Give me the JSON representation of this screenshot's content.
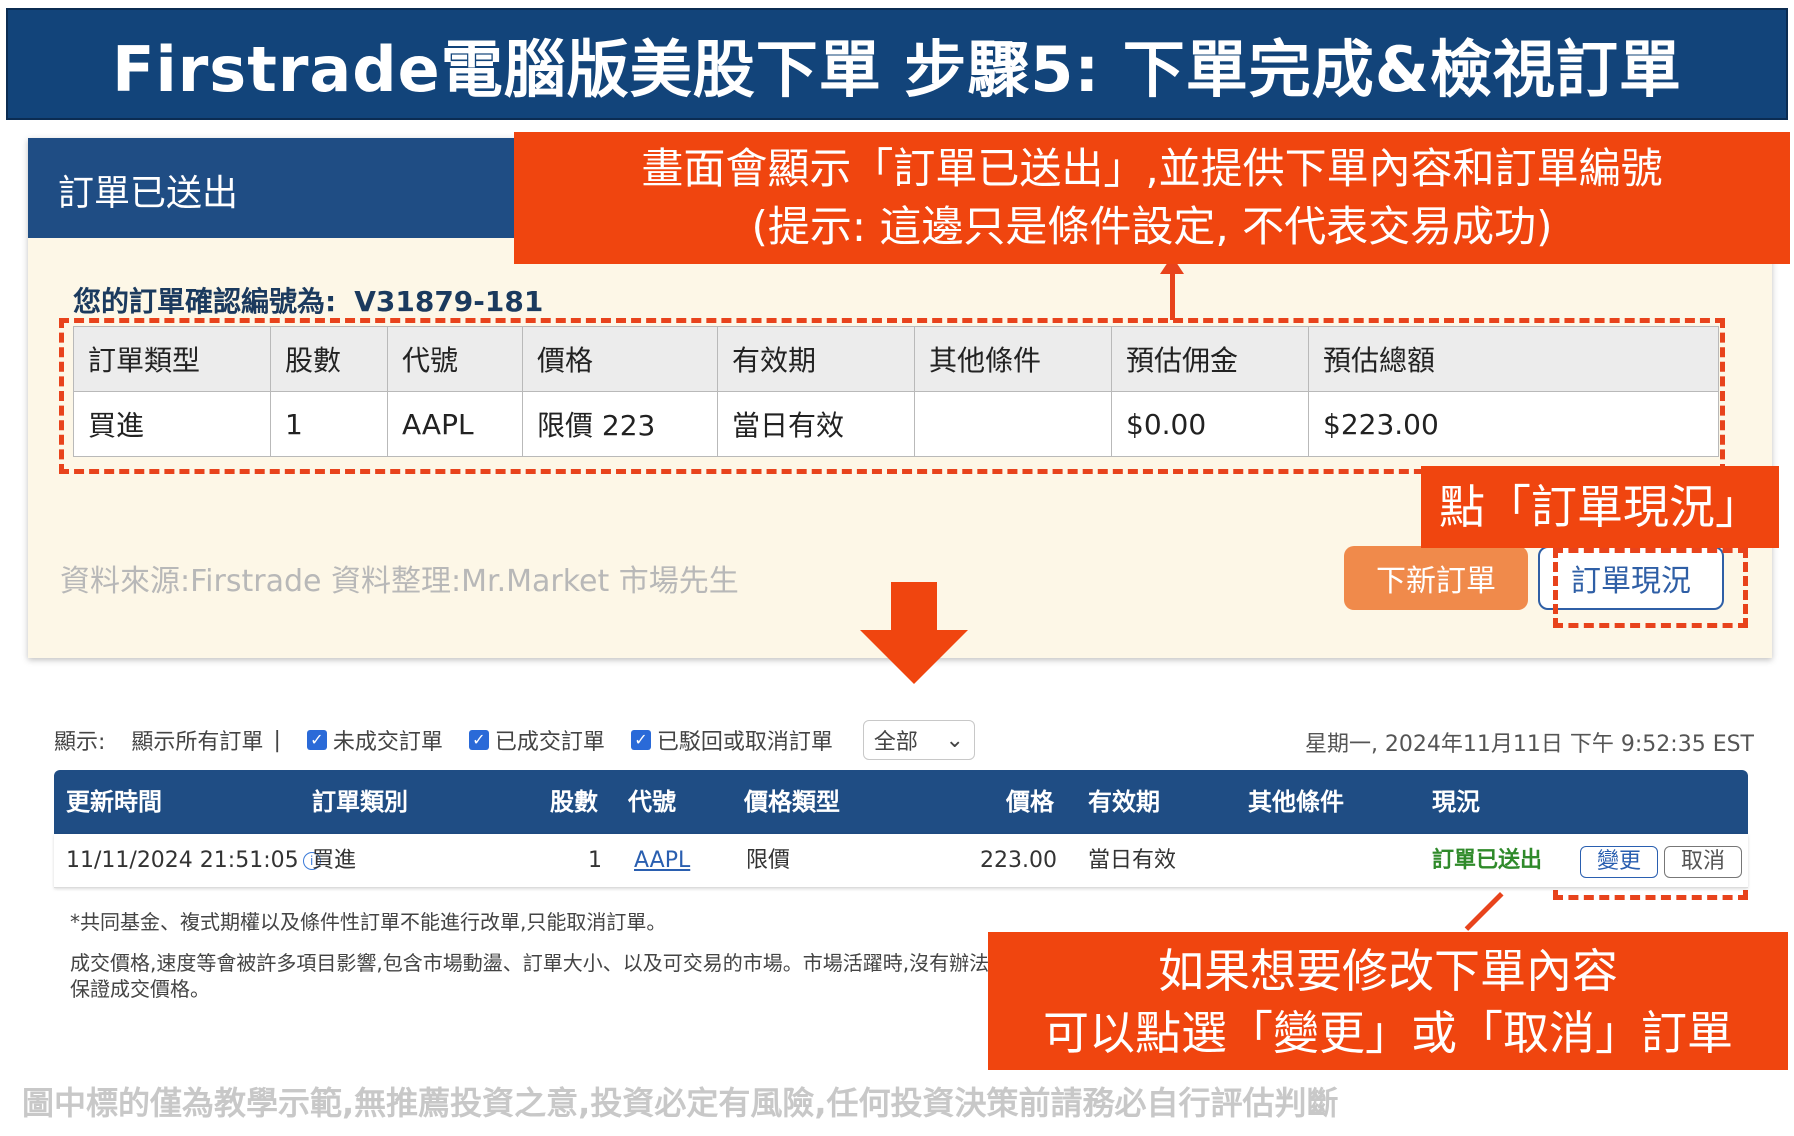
{
  "title": "Firstrade電腦版美股下單 步驟5: 下單完成&檢視訂單",
  "confirm": {
    "header_title": "訂單已送出",
    "number_label": "您的訂單確認編號為:",
    "number_value": "V31879-181",
    "table_headers": [
      "訂單類型",
      "股數",
      "代號",
      "價格",
      "有效期",
      "其他條件",
      "預估佣金",
      "預估總額"
    ],
    "table_row": [
      "買進",
      "1",
      "AAPL",
      "限價 223",
      "當日有效",
      "",
      "$0.00",
      "$223.00"
    ],
    "source_text": "資料來源:Firstrade 資料整理:Mr.Market 市場先生",
    "new_order_button": "下新訂單",
    "order_status_button": "訂單現況"
  },
  "callouts": {
    "callout_1_line_1": "畫面會顯示「訂單已送出」,並提供下單內容和訂單編號",
    "callout_1_line_2": "(提示: 這邊只是條件設定, 不代表交易成功)",
    "callout_2": "點「訂單現況」",
    "callout_3_line_1": "如果想要修改下單內容",
    "callout_3_line_2": "可以點選「變更」或「取消」訂單"
  },
  "filters": {
    "display_label": "顯示:",
    "show_all": "顯示所有訂單",
    "separator": "|",
    "unfilled": "未成交訂單",
    "filled": "已成交訂單",
    "rejected": "已駁回或取消訂單",
    "select_value": "全部",
    "datetime": "星期一, 2024年11月11日 下午 9:52:35 EST"
  },
  "status_table": {
    "headers": {
      "update_time": "更新時間",
      "order_category": "訂單類別",
      "shares": "股數",
      "symbol": "代號",
      "price_type": "價格類型",
      "price": "價格",
      "validity": "有效期",
      "other_conditions": "其他條件",
      "status": "現況"
    },
    "row": {
      "update_time": "11/11/2024 21:51:05",
      "order_category": "買進",
      "shares": "1",
      "symbol": "AAPL",
      "price_type": "限價",
      "price": "223.00",
      "validity": "當日有效",
      "other_conditions": "",
      "status": "訂單已送出",
      "change_button": "變更",
      "cancel_button": "取消"
    }
  },
  "notes": {
    "note_1": "*共同基金、複式期權以及條件性訂單不能進行改單,只能取消訂單。",
    "note_2": "成交價格,速度等會被許多項目影響,包含市場動盪、訂單大小、以及可交易的市場。市場活躍時,沒有辦法保證成交價格。"
  },
  "disclaimer": "圖中標的僅為教學示範,無推薦投資之意,投資必定有風險,任何投資決策前請務必自行評估判斷",
  "colors": {
    "banner": "#12447a",
    "callout": "#f0450f",
    "header_blue": "#1f4d84",
    "status_green": "#2f8a2a"
  }
}
